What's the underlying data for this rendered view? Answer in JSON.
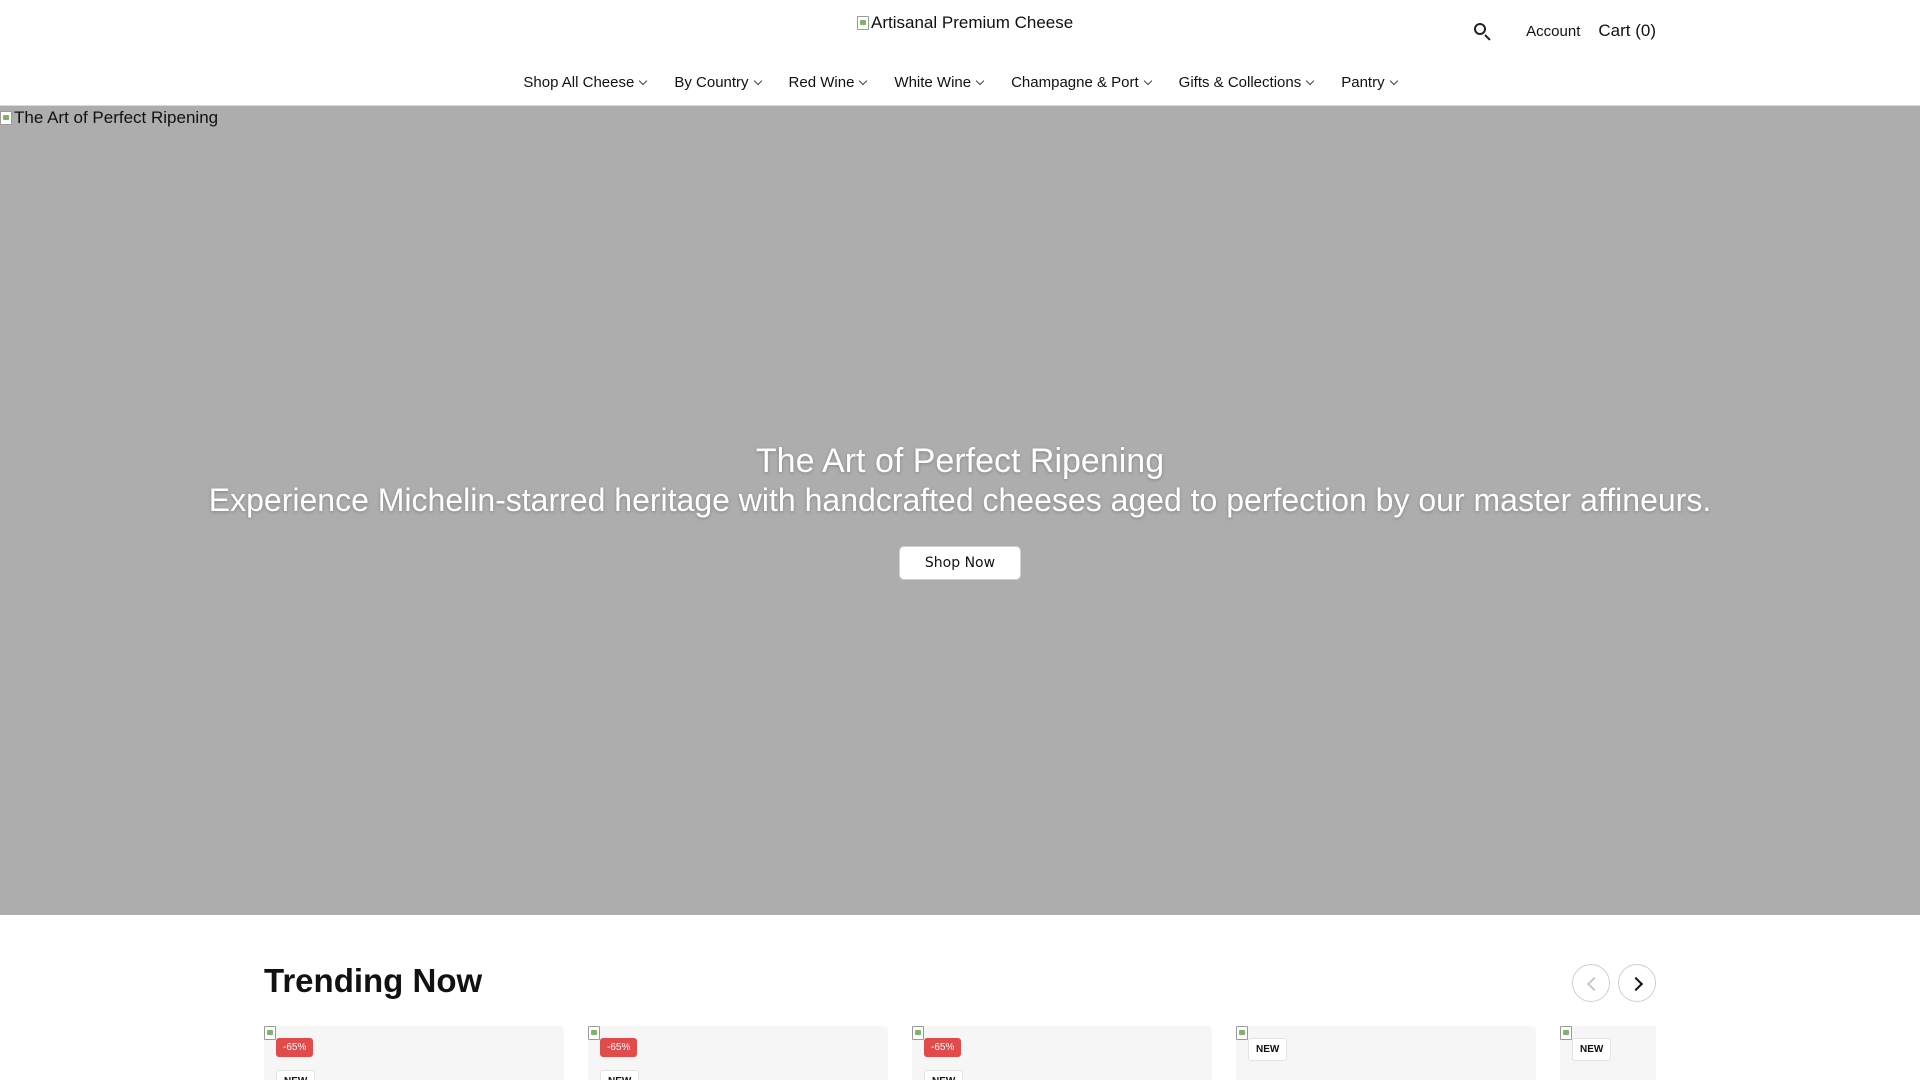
{
  "header": {
    "logo_alt": "Artisanal Premium Cheese",
    "account_label": "Account",
    "cart_label": "Cart (0)",
    "search_icon": "search-icon"
  },
  "nav": {
    "items": [
      {
        "label": "Shop All Cheese"
      },
      {
        "label": "By Country"
      },
      {
        "label": "Red Wine"
      },
      {
        "label": "White Wine"
      },
      {
        "label": "Champagne & Port"
      },
      {
        "label": "Gifts & Collections"
      },
      {
        "label": "Pantry"
      }
    ]
  },
  "hero": {
    "image_alt": "The Art of Perfect Ripening",
    "title": "The Art of Perfect Ripening",
    "subtitle": "Experience Michelin-starred heritage with handcrafted cheeses aged to perfection by our master affineurs.",
    "cta_label": "Shop Now",
    "background_color": "#adadad"
  },
  "trending": {
    "title": "Trending Now",
    "products": [
      {
        "sale_badge": "-65%",
        "new_badge": "NEW"
      },
      {
        "sale_badge": "-65%",
        "new_badge": "NEW"
      },
      {
        "sale_badge": "-65%",
        "new_badge": "NEW"
      },
      {
        "sale_badge": "",
        "new_badge": "NEW"
      },
      {
        "sale_badge": "",
        "new_badge": "NEW"
      }
    ]
  },
  "colors": {
    "sale_badge": "#e14b4b",
    "divider": "#d9d9d9"
  }
}
